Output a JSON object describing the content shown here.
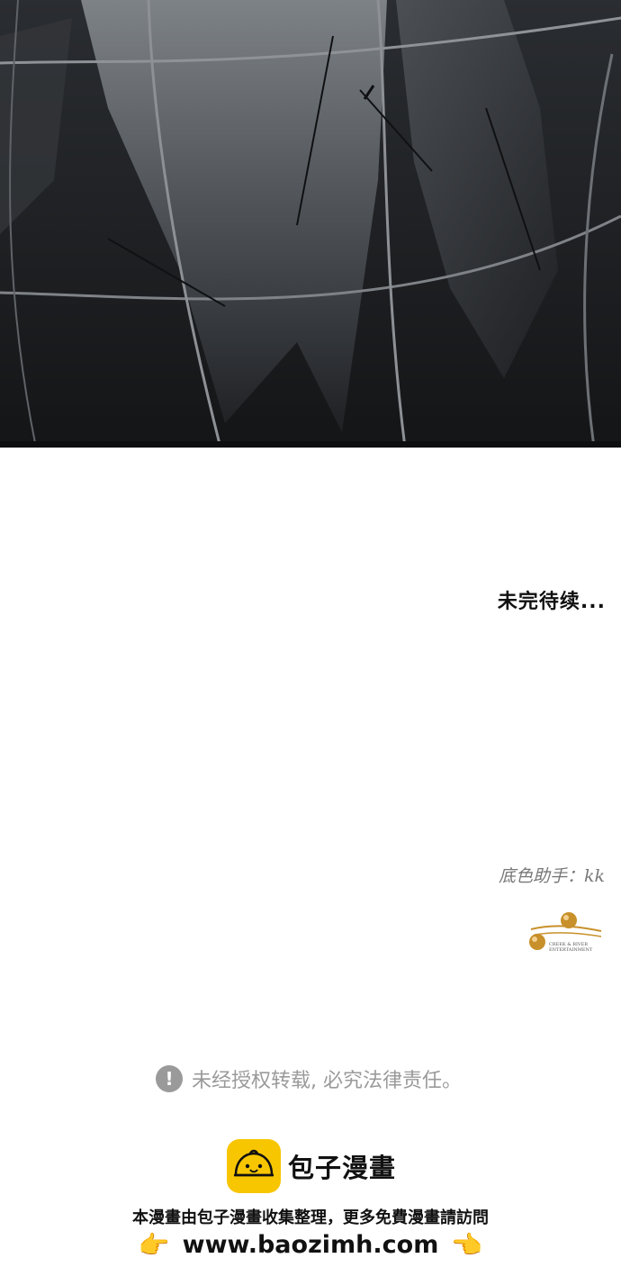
{
  "to_be_continued": "未完待续...",
  "credit_text": "底色助手：kk",
  "logo": {
    "name": "creek-river-logo",
    "text_line1": "CREEK & RIVER",
    "text_line2": "ENTERTAINMENT"
  },
  "notice": {
    "icon": "!",
    "text": "未经授权转载, 必究法律责任。"
  },
  "brand": {
    "name": "包子漫畫",
    "description": "本漫畫由包子漫畫收集整理，更多免費漫畫請訪問",
    "url": "www.baozimh.com",
    "left_hand": "👉",
    "right_hand": "👈",
    "color": "#f7c600"
  }
}
